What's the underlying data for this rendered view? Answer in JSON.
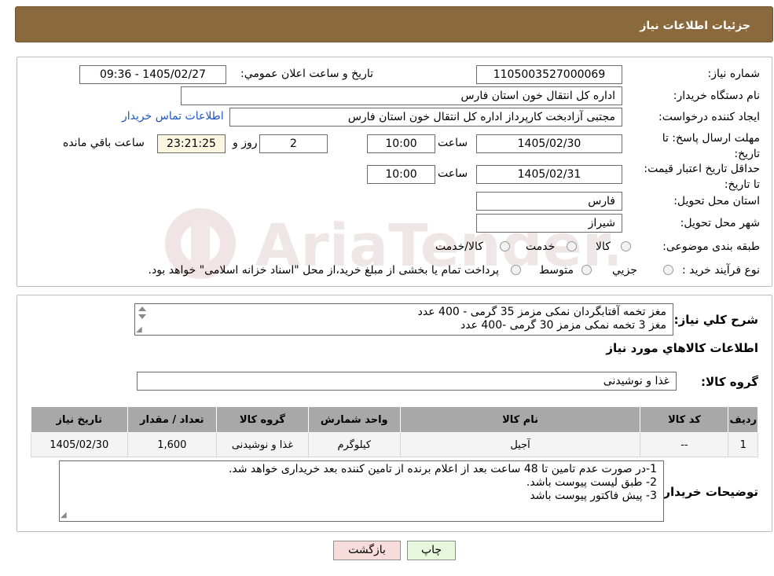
{
  "header": {
    "title": "جزئیات اطلاعات نیاز"
  },
  "form": {
    "need_number_label": "شماره نیاز:",
    "need_number": "1105003527000069",
    "announce_label": "تاريخ و ساعت اعلان عمومي:",
    "announce_value": "1405/02/27 - 09:36",
    "buyer_org_label": "نام دستگاه خريدار:",
    "buyer_org": "اداره کل انتقال خون استان فارس",
    "requester_label": "ايجاد کننده درخواست:",
    "requester": "مجتبی آزادبخت کارپرداز اداره کل انتقال خون استان فارس",
    "contact_link": "اطلاعات تماس خريدار",
    "deadline_label": "مهلت ارسال پاسخ: تا تاريخ:",
    "deadline_date": "1405/02/30",
    "time_label": "ساعت",
    "deadline_time": "10:00",
    "days_value": "2",
    "days_label": "روز و",
    "remaining_time": "23:21:25",
    "remaining_label": "ساعت باقي مانده",
    "validity_label": "حداقل تاريخ اعتبار قيمت: تا تاريخ:",
    "validity_date": "1405/02/31",
    "validity_time": "10:00",
    "province_label": "استان محل تحويل:",
    "province": "فارس",
    "city_label": "شهر محل تحويل:",
    "city": "شيراز",
    "category_label": "طبقه بندی موضوعی:",
    "category_options": [
      "کالا",
      "خدمت",
      "کالا/خدمت"
    ],
    "process_label": "نوع فرآيند خريد :",
    "process_options": [
      "جزيي",
      "متوسط"
    ],
    "process_note": "پرداخت تمام يا بخشی از مبلغ خريد،از محل \"اسناد خزانه اسلامی\" خواهد بود."
  },
  "details": {
    "summary_label": "شرح کلي نياز:",
    "summary_lines": [
      "مغز تخمه آفتابگردان نمکی مزمز 35 گرمی - 400 عدد",
      "مغز 3 تخمه نمکی مزمز 30 گرمی -400 عدد"
    ],
    "goods_info_title": "اطلاعات کالاهاي مورد نياز",
    "group_label": "گروه کالا:",
    "group_value": "غذا و نوشيدنی"
  },
  "table": {
    "headers": [
      "رديف",
      "کد کالا",
      "نام کالا",
      "واحد شمارش",
      "گروه کالا",
      "تعداد / مقدار",
      "تاريخ نياز"
    ],
    "rows": [
      [
        "1",
        "--",
        "آجیل",
        "کيلوگرم",
        "غذا و نوشيدنی",
        "1,600",
        "1405/02/30"
      ]
    ]
  },
  "notes": {
    "label": "توضيحات خريدار:",
    "lines": [
      "1-در صورت عدم تامین تا 48 ساعت بعد از اعلام برنده  از تامین کننده بعد خریداری خواهد شد.",
      "2- طبق لیست پیوست باشد.",
      "3- پیش فاکتور پیوست باشد"
    ]
  },
  "buttons": {
    "print": "چاپ",
    "back": "بازگشت"
  },
  "watermark": {
    "text": "AriaTender.neT"
  },
  "colors": {
    "header_bg": "#8a6a3c",
    "link": "#1a55c8",
    "back_btn": "#f8dcdc",
    "print_btn": "#e6f7dc",
    "watermark": "#e9dede"
  }
}
